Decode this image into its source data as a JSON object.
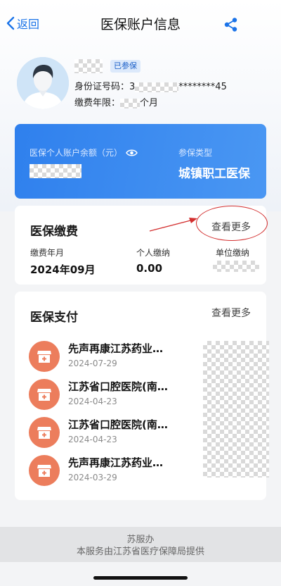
{
  "nav": {
    "back_label": "返回",
    "title": "医保账户信息"
  },
  "profile": {
    "badge": "已参保",
    "id_label": "身份证号码：",
    "id_prefix": "3",
    "id_suffix": "********45",
    "years_label": "缴费年限：",
    "years_unit": "个月"
  },
  "account": {
    "balance_label": "医保个人账户余额（元）",
    "type_label": "参保类型",
    "type_value": "城镇职工医保"
  },
  "payment": {
    "title": "医保缴费",
    "more_label": "查看更多",
    "col1_label": "缴费年月",
    "col2_label": "个人缴纳",
    "col3_label": "单位缴纳",
    "col1_value": "2024年09月",
    "col2_value": "0.00"
  },
  "expense": {
    "title": "医保支付",
    "more_label": "查看更多",
    "records": [
      {
        "name": "先声再康江苏药业…",
        "date": "2024-07-29"
      },
      {
        "name": "江苏省口腔医院(南…",
        "date": "2024-04-23"
      },
      {
        "name": "江苏省口腔医院(南…",
        "date": "2024-04-23"
      },
      {
        "name": "先声再康江苏药业…",
        "date": "2024-03-29"
      }
    ]
  },
  "footer": {
    "line1": "苏服办",
    "line2": "本服务由江苏省医疗保障局提供"
  },
  "colors": {
    "accent": "#1a73e8",
    "card_blue": "#2f80ed",
    "icon_orange": "#ec7d5c",
    "annotation_red": "#d32f2f"
  },
  "icons": [
    "back-chevron-icon",
    "share-icon",
    "eye-icon",
    "pharmacy-icon"
  ]
}
